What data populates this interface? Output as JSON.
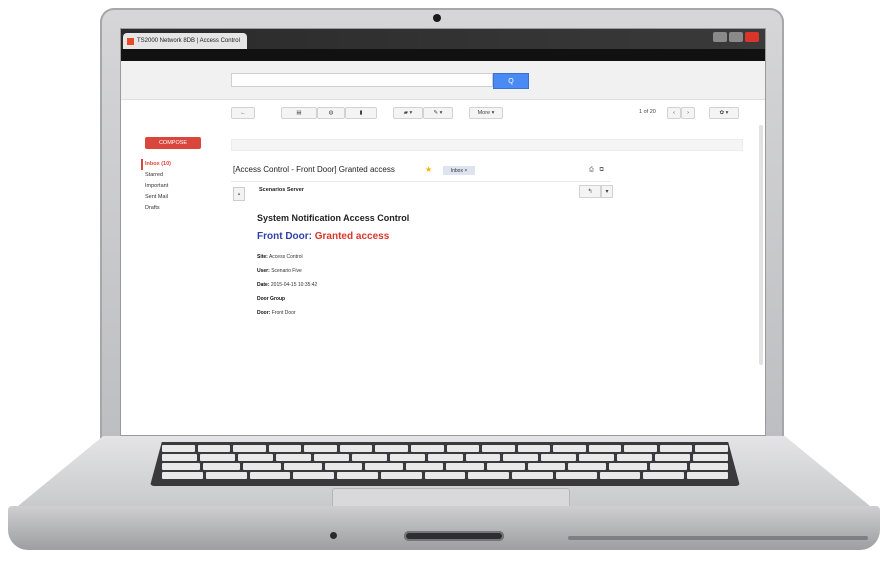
{
  "browser": {
    "tab_title": "TS2000 Network 8DB | Access Control"
  },
  "search": {
    "placeholder": "",
    "button": "Q"
  },
  "toolbar": {
    "back": "←",
    "archive": "▤",
    "spam": "◍",
    "delete": "▮",
    "move": "▰ ▾",
    "labels": "✎ ▾",
    "more": "More ▾",
    "pager": "1 of 20",
    "prev": "‹",
    "next": "›",
    "settings": "✿ ▾"
  },
  "sidebar": {
    "compose": "COMPOSE",
    "items": [
      "Inbox (10)",
      "Starred",
      "Important",
      "Sent Mail",
      "Drafts"
    ]
  },
  "message": {
    "subject": "[Access Control - Front Door] Granted access",
    "label": "Inbox ×",
    "header_icons": "⎙ ⧉",
    "sender": "Scenarios Server",
    "reply": "↰",
    "more": "▾",
    "heading": "System Notification Access Control",
    "location": "Front Door",
    "separator": ": ",
    "status": "Granted access",
    "fields": [
      {
        "label": "Site:",
        "value": "Access Control"
      },
      {
        "label": "User:",
        "value": "Scenario Five"
      },
      {
        "label": "Date:",
        "value": "2015-04-15 10:35:42"
      },
      {
        "label": "Door Group",
        "value": ""
      },
      {
        "label": "Door:",
        "value": "Front Door"
      }
    ]
  },
  "colors": {
    "accent_red": "#d9463b",
    "search_blue": "#4a8af4",
    "location_blue": "#2f3fa8",
    "status_red": "#d9352a"
  }
}
